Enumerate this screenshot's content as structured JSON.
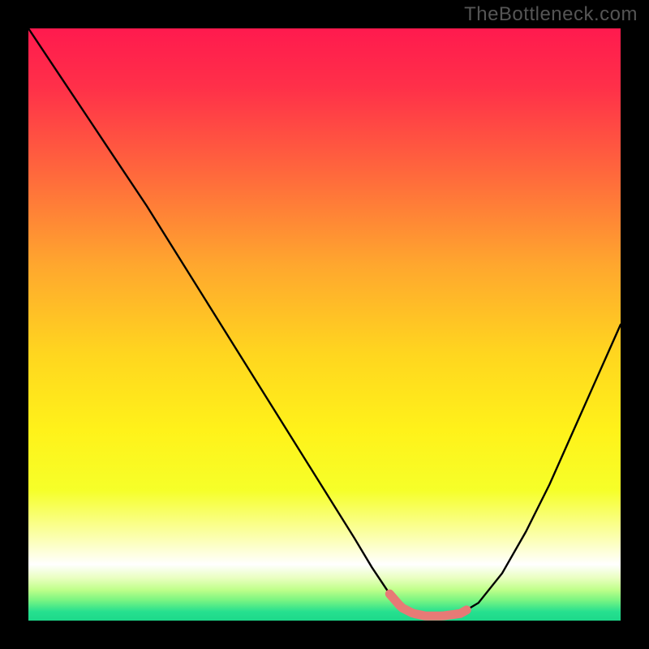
{
  "watermark": "TheBottleneck.com",
  "colors": {
    "frame": "#000000",
    "watermark": "#555555",
    "curve": "#000000",
    "accent_band": "#E77A76",
    "gradient_stops": [
      {
        "offset": 0.0,
        "color": "#FF1A4E"
      },
      {
        "offset": 0.1,
        "color": "#FF3049"
      },
      {
        "offset": 0.25,
        "color": "#FF6A3C"
      },
      {
        "offset": 0.4,
        "color": "#FFA72E"
      },
      {
        "offset": 0.55,
        "color": "#FFD61F"
      },
      {
        "offset": 0.68,
        "color": "#FFF21A"
      },
      {
        "offset": 0.78,
        "color": "#F6FF29"
      },
      {
        "offset": 0.86,
        "color": "#FBFFB0"
      },
      {
        "offset": 0.905,
        "color": "#FFFFFF"
      },
      {
        "offset": 0.928,
        "color": "#E9FFC0"
      },
      {
        "offset": 0.948,
        "color": "#BFFF8A"
      },
      {
        "offset": 0.965,
        "color": "#7CF582"
      },
      {
        "offset": 0.985,
        "color": "#26E08F"
      },
      {
        "offset": 1.0,
        "color": "#1DD98A"
      }
    ]
  },
  "chart_data": {
    "type": "line",
    "title": "",
    "xlabel": "",
    "ylabel": "",
    "xlim": [
      0,
      100
    ],
    "ylim": [
      0,
      100
    ],
    "grid": false,
    "series": [
      {
        "name": "bottleneck-curve",
        "x": [
          0,
          5,
          10,
          15,
          20,
          25,
          30,
          35,
          40,
          45,
          50,
          55,
          58,
          61,
          63,
          65,
          67,
          70,
          73,
          76,
          80,
          84,
          88,
          92,
          96,
          100
        ],
        "y": [
          100,
          92.5,
          85,
          77.5,
          70,
          62,
          54,
          46,
          38,
          30,
          22,
          14,
          9,
          4.5,
          2.2,
          1.2,
          0.8,
          0.8,
          1.2,
          3.0,
          8,
          15,
          23,
          32,
          41,
          50
        ]
      }
    ],
    "annotations": [
      {
        "name": "optimal-band",
        "x_min": 61,
        "x_max": 74,
        "y": 1.0,
        "style": "thick-rounded",
        "color": "#E77A76"
      }
    ]
  }
}
